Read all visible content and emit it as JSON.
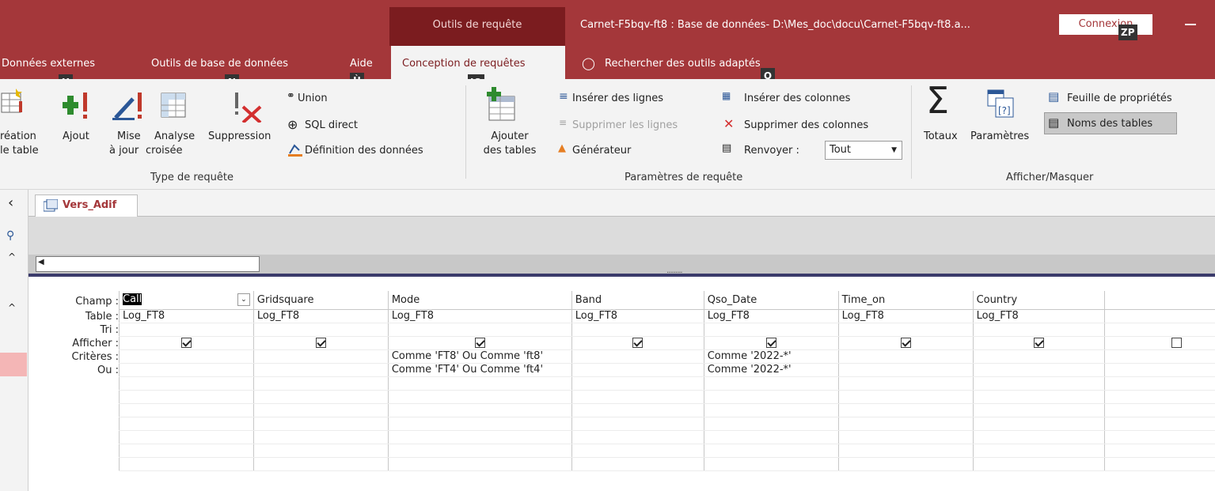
{
  "titlebar": {
    "context_group": "Outils de requête",
    "window_title": "Carnet-F5bqv-ft8 : Base de données- D:\\Mes_doc\\docu\\Carnet-F5bqv-ft8.a...",
    "connect_label": "Connexion",
    "colors": {
      "title_bg": "#a4373a",
      "context_bg": "#7b1c1f"
    }
  },
  "tabs": {
    "external": "Données externes",
    "db_tools": "Outils de base de données",
    "help": "Aide",
    "design": "Conception de requêtes",
    "tell_me": "Rechercher des outils adaptés"
  },
  "keytips": {
    "external": "X",
    "db_tools": "N",
    "help": "Ù",
    "design": "JQ",
    "tell_me": "Q",
    "connect": "ZP"
  },
  "ribbon": {
    "query_type": {
      "make_table": "réation",
      "make_table_2": "le table",
      "append": "Ajout",
      "update": "Mise",
      "update_2": "à jour",
      "crosstab": "Analyse",
      "crosstab_2": "croisée",
      "delete": "Suppression",
      "union": "Union",
      "pass_through": "SQL direct",
      "data_def": "Définition des données",
      "group_label": "Type de requête"
    },
    "setup": {
      "add_tables": "Ajouter",
      "add_tables_2": "des tables",
      "insert_rows": "Insérer des lignes",
      "delete_rows": "Supprimer les lignes",
      "builder": "Générateur",
      "insert_cols": "Insérer des colonnes",
      "delete_cols": "Supprimer des colonnes",
      "return_label": "Renvoyer :",
      "return_value": "Tout",
      "group_label": "Paramètres de requête"
    },
    "show_hide": {
      "totals": "Totaux",
      "params": "Paramètres",
      "prop_sheet": "Feuille de propriétés",
      "table_names": "Noms des tables",
      "group_label": "Afficher/Masquer"
    }
  },
  "document": {
    "tab_name": "Vers_Adif"
  },
  "qbe": {
    "row_labels": [
      "Champ :",
      "Table :",
      "Tri :",
      "Afficher :",
      "Critères :",
      "Ou :"
    ],
    "columns": [
      {
        "field": "Call",
        "table": "Log_FT8",
        "show": true,
        "criteria": "",
        "or": ""
      },
      {
        "field": "Gridsquare",
        "table": "Log_FT8",
        "show": true,
        "criteria": "",
        "or": ""
      },
      {
        "field": "Mode",
        "table": "Log_FT8",
        "show": true,
        "criteria": "Comme 'FT8' Ou Comme 'ft8'",
        "or": "Comme 'FT4' Ou Comme 'ft4'"
      },
      {
        "field": "Band",
        "table": "Log_FT8",
        "show": true,
        "criteria": "",
        "or": ""
      },
      {
        "field": "Qso_Date",
        "table": "Log_FT8",
        "show": true,
        "criteria": "Comme '2022-*'",
        "or": "Comme '2022-*'"
      },
      {
        "field": "Time_on",
        "table": "Log_FT8",
        "show": true,
        "criteria": "",
        "or": ""
      },
      {
        "field": "Country",
        "table": "Log_FT8",
        "show": true,
        "criteria": "",
        "or": ""
      },
      {
        "field": "",
        "table": "",
        "show": false,
        "criteria": "",
        "or": ""
      }
    ]
  }
}
